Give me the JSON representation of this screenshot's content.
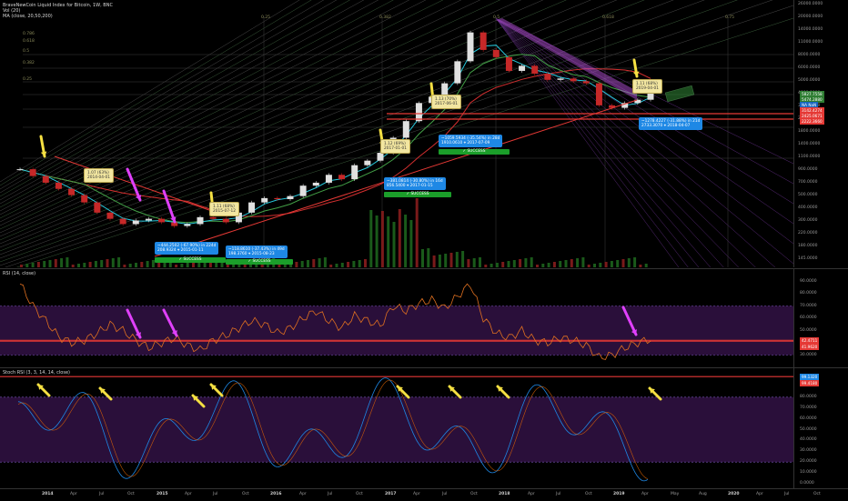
{
  "header": {
    "title": "BraveNewCoin Liquid Index for Bitcoin, 1W, BNC",
    "vol": "Vol (20)",
    "ma": "MA (close, 20,50,200)",
    "rsi": "RSI (14, close)",
    "stoch": "Stoch RSI (3, 3, 14, 14, close)"
  },
  "chart_data": [
    {
      "type": "line",
      "panel": "price",
      "scale": "log",
      "ylim": [
        100,
        26000
      ],
      "price_ticks": [
        "26000.0000",
        "20000.0000",
        "14000.0000",
        "11000.0000",
        "8000.0000",
        "6000.0000",
        "5000.0000",
        "4000.0000",
        "3000.0000",
        "2200.0000",
        "1800.0000",
        "1400.0000",
        "1100.0000",
        "900.0000",
        "700.0000",
        "500.0000",
        "400.0000",
        "300.0000",
        "220.0000",
        "180.0000",
        "145.0000"
      ],
      "fib_labels": [
        "0.25",
        "0.382",
        "0.5",
        "0.618",
        "0.75"
      ],
      "fib_left": [
        "0.786",
        "0.618",
        "0.5",
        "0.382",
        "0.25"
      ],
      "series": [
        {
          "values": [
            820,
            700,
            600,
            520,
            450,
            380,
            300,
            260,
            230,
            250,
            260,
            240,
            220,
            230,
            270,
            260,
            240,
            300,
            380,
            420,
            410,
            440,
            560,
            600,
            720,
            650,
            900,
            1000,
            1200,
            1700,
            2500,
            3800,
            4400,
            6000,
            10000,
            19500,
            13000,
            11000,
            8000,
            9000,
            7500,
            6500,
            6700,
            6300,
            6000,
            3600,
            3400,
            3800,
            4100,
            5100
          ]
        }
      ],
      "annotations": [
        {
          "text": "~444.2502 (-67.90%) in 224d",
          "sub": "208.9324  ⌖ 2015-01-11"
        },
        {
          "text": "~118.8610 (-37.43%) in 49d",
          "sub": "198.3760  ⌖ 2015-08-23"
        },
        {
          "text": "~381.0814 (-30.80%) in 16d",
          "sub": "856.5400  ⌖ 2017-01-15"
        },
        {
          "text": "~1059.5934 (-35.54%) in 28d",
          "sub": "1910.0610  ⌖ 2017-07-09"
        },
        {
          "text": "~1278.4227 (-31.88%) in 21d",
          "sub": "2733.3070  ⌖ 2018-04-07"
        }
      ],
      "success_label": "✓ SUCCESS",
      "price_badges": [
        "5827.7558",
        "5474.2880",
        "NA NaN",
        "3142.4274",
        "2425.0671",
        "2222.3660"
      ]
    },
    {
      "type": "line",
      "panel": "rsi",
      "ylim": [
        20,
        100
      ],
      "ticks": [
        "90.0000",
        "80.0000",
        "70.0000",
        "60.0000",
        "50.0000",
        "40.0000",
        "30.0000"
      ],
      "badges": [
        "42.4711",
        "41.9620"
      ],
      "series": [
        {
          "values": [
            88,
            70,
            58,
            45,
            40,
            42,
            48,
            55,
            50,
            42,
            36,
            40,
            44,
            38,
            34,
            42,
            46,
            52,
            58,
            55,
            48,
            52,
            60,
            66,
            58,
            52,
            62,
            58,
            54,
            70,
            66,
            72,
            75,
            68,
            78,
            88,
            60,
            48,
            44,
            50,
            42,
            40,
            44,
            42,
            38,
            28,
            30,
            36,
            40,
            43
          ]
        }
      ]
    },
    {
      "type": "line",
      "panel": "stoch",
      "ylim": [
        0,
        100
      ],
      "ticks": [
        "90.0000",
        "80.0000",
        "70.0000",
        "60.0000",
        "50.0000",
        "40.0000",
        "30.0000",
        "20.0000",
        "10.0000",
        "0.0000"
      ],
      "badges": [
        "99.1320",
        "99.4180"
      ],
      "x_ticks": [
        "2014",
        "Apr",
        "Jul",
        "Oct",
        "2015",
        "Apr",
        "Jul",
        "Oct",
        "2016",
        "Apr",
        "Jul",
        "Oct",
        "2017",
        "Apr",
        "Jul",
        "Oct",
        "2018",
        "Apr",
        "Jul",
        "Oct",
        "2019",
        "Apr",
        "May",
        "Aug",
        "2020",
        "Apr",
        "Jul",
        "Oct"
      ]
    }
  ]
}
